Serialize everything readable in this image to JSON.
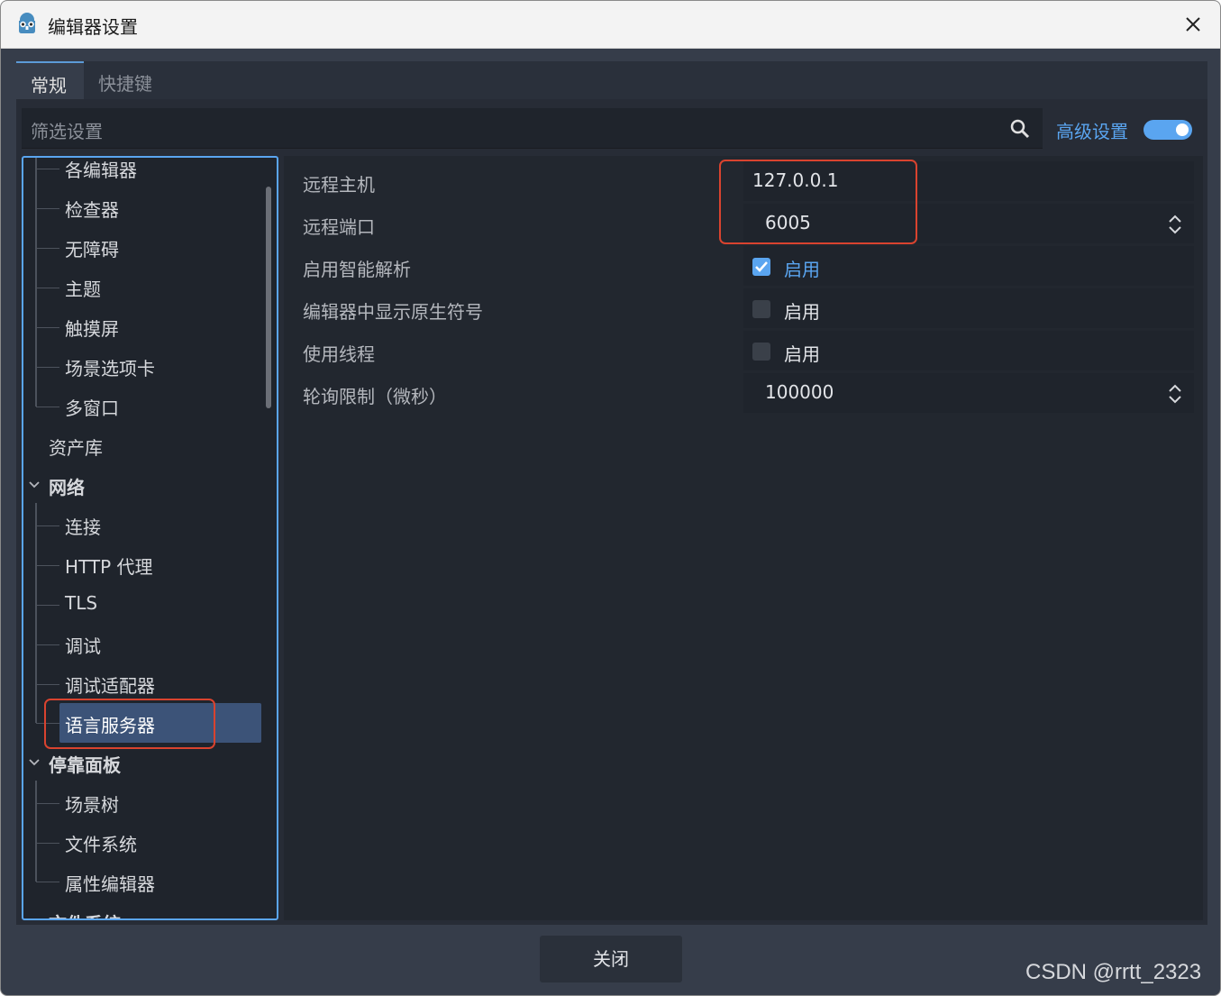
{
  "window": {
    "title": "编辑器设置"
  },
  "tabs": [
    {
      "label": "常规"
    },
    {
      "label": "快捷键"
    }
  ],
  "filter": {
    "placeholder": "筛选设置"
  },
  "advanced": {
    "label": "高级设置",
    "enabled": true
  },
  "tree": {
    "items": [
      {
        "label": "各编辑器",
        "level": 2
      },
      {
        "label": "检查器",
        "level": 2
      },
      {
        "label": "无障碍",
        "level": 2
      },
      {
        "label": "主题",
        "level": 2
      },
      {
        "label": "触摸屏",
        "level": 2
      },
      {
        "label": "场景选项卡",
        "level": 2
      },
      {
        "label": "多窗口",
        "level": 2
      },
      {
        "label": "资产库",
        "level": 1
      },
      {
        "label": "网络",
        "level": 1,
        "expanded": true
      },
      {
        "label": "连接",
        "level": 2
      },
      {
        "label": "HTTP 代理",
        "level": 2
      },
      {
        "label": "TLS",
        "level": 2
      },
      {
        "label": "调试",
        "level": 2
      },
      {
        "label": "调试适配器",
        "level": 2
      },
      {
        "label": "语言服务器",
        "level": 2,
        "selected": true
      },
      {
        "label": "停靠面板",
        "level": 1,
        "expanded": true
      },
      {
        "label": "场景树",
        "level": 2
      },
      {
        "label": "文件系统",
        "level": 2
      },
      {
        "label": "属性编辑器",
        "level": 2
      },
      {
        "label": "文件系统",
        "level": 1
      }
    ]
  },
  "properties": [
    {
      "label": "远程主机",
      "value": "127.0.0.1"
    },
    {
      "label": "远程端口",
      "value": "6005"
    },
    {
      "label": "启用智能解析",
      "checkbox_label": "启用",
      "checked": true
    },
    {
      "label": "编辑器中显示原生符号",
      "checkbox_label": "启用",
      "checked": false
    },
    {
      "label": "使用线程",
      "checkbox_label": "启用",
      "checked": false
    },
    {
      "label": "轮询限制（微秒）",
      "value": "100000"
    }
  ],
  "footer": {
    "close_label": "关闭"
  },
  "watermark": "CSDN @rrtt_2323",
  "colors": {
    "accent": "#5aa5f0",
    "highlight": "#d9432f",
    "panel": "#272c36",
    "selected": "#3c5378"
  }
}
